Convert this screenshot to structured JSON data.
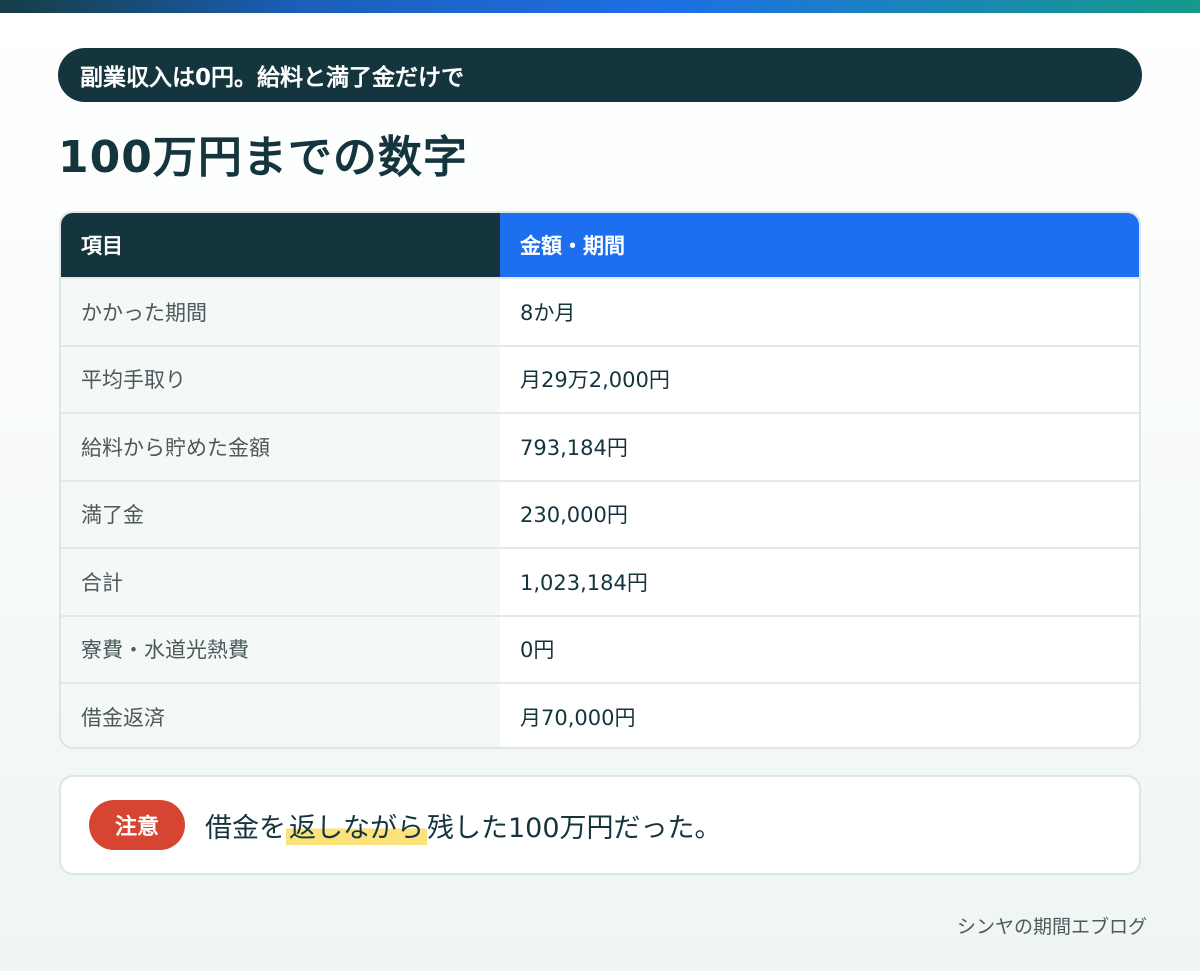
{
  "header": {
    "pill_text": "副業収入は0円。給料と満了金だけで",
    "title": "100万円までの数字"
  },
  "table": {
    "headers": [
      "項目",
      "金額・期間"
    ],
    "rows": [
      {
        "label": "かかった期間",
        "value": "8か月"
      },
      {
        "label": "平均手取り",
        "value": "月29万2,000円"
      },
      {
        "label": "給料から貯めた金額",
        "value": "793,184円"
      },
      {
        "label": "満了金",
        "value": "230,000円"
      },
      {
        "label": "合計",
        "value": "1,023,184円"
      },
      {
        "label": "寮費・水道光熱費",
        "value": "0円"
      },
      {
        "label": "借金返済",
        "value": "月70,000円"
      }
    ]
  },
  "note": {
    "badge": "注意",
    "text_before": "借金を",
    "text_highlight": "返しながら",
    "text_after": "残した100万円だった。"
  },
  "footer": {
    "blog_name": "シンヤの期間エブログ"
  },
  "colors": {
    "dark": "#14353d",
    "accent_blue": "#1e6ff0",
    "badge_red": "#d64532",
    "highlight_yellow": "#fbe27a"
  }
}
